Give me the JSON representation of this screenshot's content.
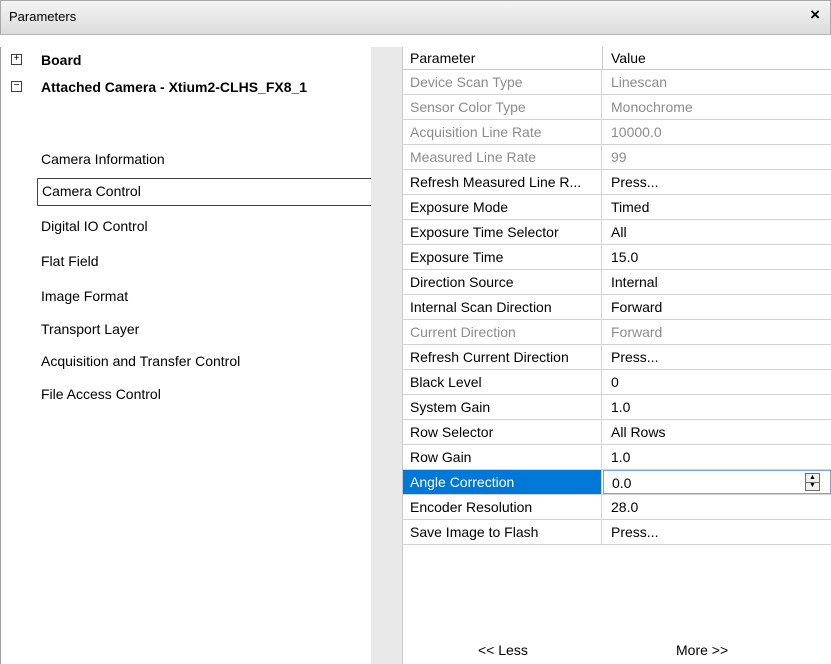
{
  "window": {
    "title": "Parameters",
    "close_glyph": "×"
  },
  "tree": {
    "nodes": [
      {
        "label": "Board",
        "expander": "+"
      },
      {
        "label": "Attached Camera - Xtium2-CLHS_FX8_1",
        "expander": "−"
      }
    ],
    "items": [
      "Camera Information",
      "Camera Control",
      "Digital IO Control",
      "Flat Field",
      "Image Format",
      "Transport Layer",
      "Acquisition and Transfer Control",
      "File Access Control"
    ],
    "selected_item": "Camera Control"
  },
  "grid": {
    "headers": {
      "parameter": "Parameter",
      "value": "Value"
    },
    "rows": [
      {
        "parameter": "Device Scan Type",
        "value": "Linescan",
        "state": "disabled"
      },
      {
        "parameter": "Sensor Color Type",
        "value": "Monochrome",
        "state": "disabled"
      },
      {
        "parameter": "Acquisition Line Rate",
        "value": "10000.0",
        "state": "disabled"
      },
      {
        "parameter": "Measured Line Rate",
        "value": "99",
        "state": "disabled"
      },
      {
        "parameter": "Refresh Measured Line R...",
        "value": "Press...",
        "state": "normal"
      },
      {
        "parameter": "Exposure Mode",
        "value": "Timed",
        "state": "normal"
      },
      {
        "parameter": "Exposure Time Selector",
        "value": "All",
        "state": "normal"
      },
      {
        "parameter": "Exposure Time",
        "value": "15.0",
        "state": "normal"
      },
      {
        "parameter": "Direction Source",
        "value": "Internal",
        "state": "normal"
      },
      {
        "parameter": "Internal Scan Direction",
        "value": "Forward",
        "state": "normal"
      },
      {
        "parameter": "Current Direction",
        "value": "Forward",
        "state": "disabled"
      },
      {
        "parameter": "Refresh Current Direction",
        "value": "Press...",
        "state": "normal"
      },
      {
        "parameter": "Black Level",
        "value": "0",
        "state": "normal"
      },
      {
        "parameter": "System Gain",
        "value": "1.0",
        "state": "normal"
      },
      {
        "parameter": "Row Selector",
        "value": "All Rows",
        "state": "normal"
      },
      {
        "parameter": "Row Gain",
        "value": "1.0",
        "state": "normal"
      },
      {
        "parameter": "Angle Correction",
        "value": "0.0",
        "state": "selected"
      },
      {
        "parameter": "Encoder Resolution",
        "value": "28.0",
        "state": "normal"
      },
      {
        "parameter": "Save Image to Flash",
        "value": "Press...",
        "state": "normal"
      }
    ]
  },
  "footer": {
    "less_label": "<< Less",
    "more_label": "More >>"
  },
  "colors": {
    "selection": "#0078d7",
    "disabled_text": "#8c8c8c"
  },
  "icons": {
    "close": "close-icon",
    "expand": "plus-box-icon",
    "collapse": "minus-box-icon",
    "spinner": "spin-updown-icon"
  }
}
